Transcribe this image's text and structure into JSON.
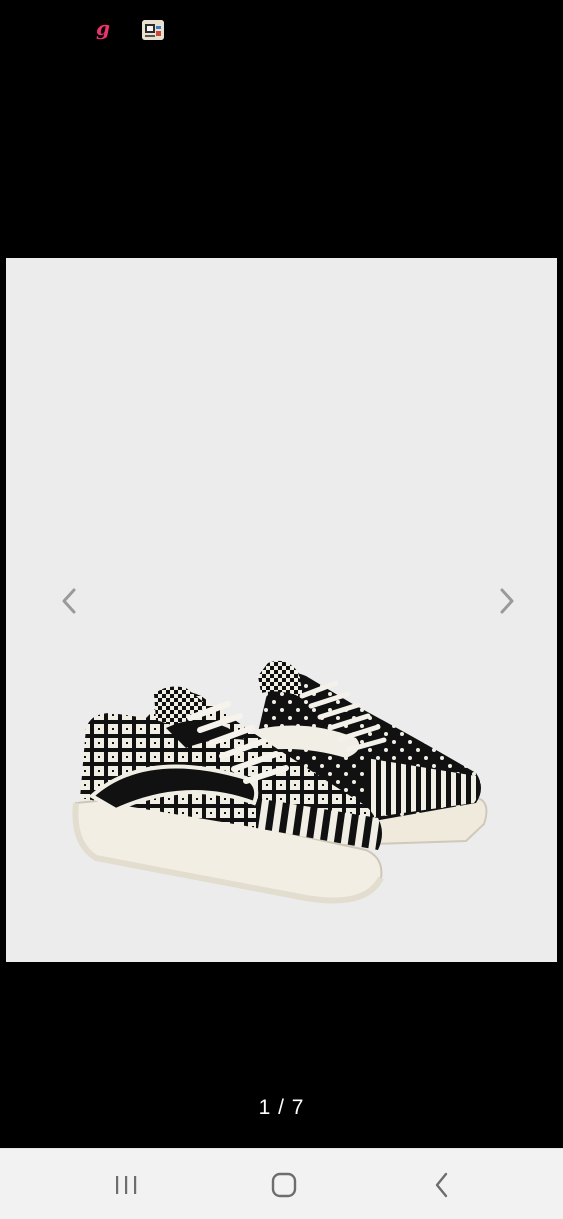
{
  "status_bar": {
    "notification_icons": [
      {
        "name": "g-app-notification-icon",
        "glyph": "g",
        "color": "#e8336d"
      },
      {
        "name": "gallery-app-notification-icon"
      }
    ]
  },
  "viewer": {
    "background": "#000000",
    "image_background": "#ececec",
    "image": {
      "subject": "low-top-sneakers-pair",
      "colors": [
        "#111111",
        "#f2efe6"
      ]
    },
    "prev_icon": "chevron-left-icon",
    "next_icon": "chevron-right-icon",
    "page_counter": "1 / 7",
    "current_page": 1,
    "total_pages": 7
  },
  "system_nav": {
    "recent_icon": "recent-apps-icon",
    "home_icon": "home-icon",
    "back_icon": "back-icon",
    "background": "#f2f2f2"
  }
}
